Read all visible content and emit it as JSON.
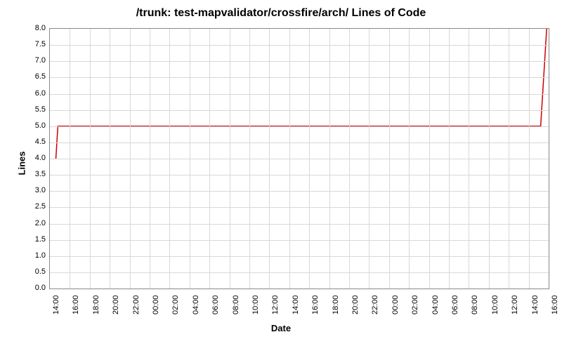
{
  "chart_data": {
    "type": "line",
    "title": "/trunk: test-mapvalidator/crossfire/arch/ Lines of Code",
    "xlabel": "Date",
    "ylabel": "Lines",
    "ylim": [
      0.0,
      8.0
    ],
    "y_ticks": [
      0.0,
      0.5,
      1.0,
      1.5,
      2.0,
      2.5,
      3.0,
      3.5,
      4.0,
      4.5,
      5.0,
      5.5,
      6.0,
      6.5,
      7.0,
      7.5,
      8.0
    ],
    "x_categories": [
      "14:00",
      "16:00",
      "18:00",
      "20:00",
      "22:00",
      "00:00",
      "02:00",
      "04:00",
      "06:00",
      "08:00",
      "10:00",
      "12:00",
      "14:00",
      "16:00",
      "18:00",
      "20:00",
      "22:00",
      "00:00",
      "02:00",
      "04:00",
      "06:00",
      "08:00",
      "10:00",
      "12:00",
      "14:00",
      "16:00"
    ],
    "series": [
      {
        "name": "Lines",
        "color": "#cc0000",
        "x_index": [
          0.3,
          0.4,
          24.6,
          24.9
        ],
        "values": [
          4.0,
          5.0,
          5.0,
          8.0
        ]
      }
    ]
  }
}
